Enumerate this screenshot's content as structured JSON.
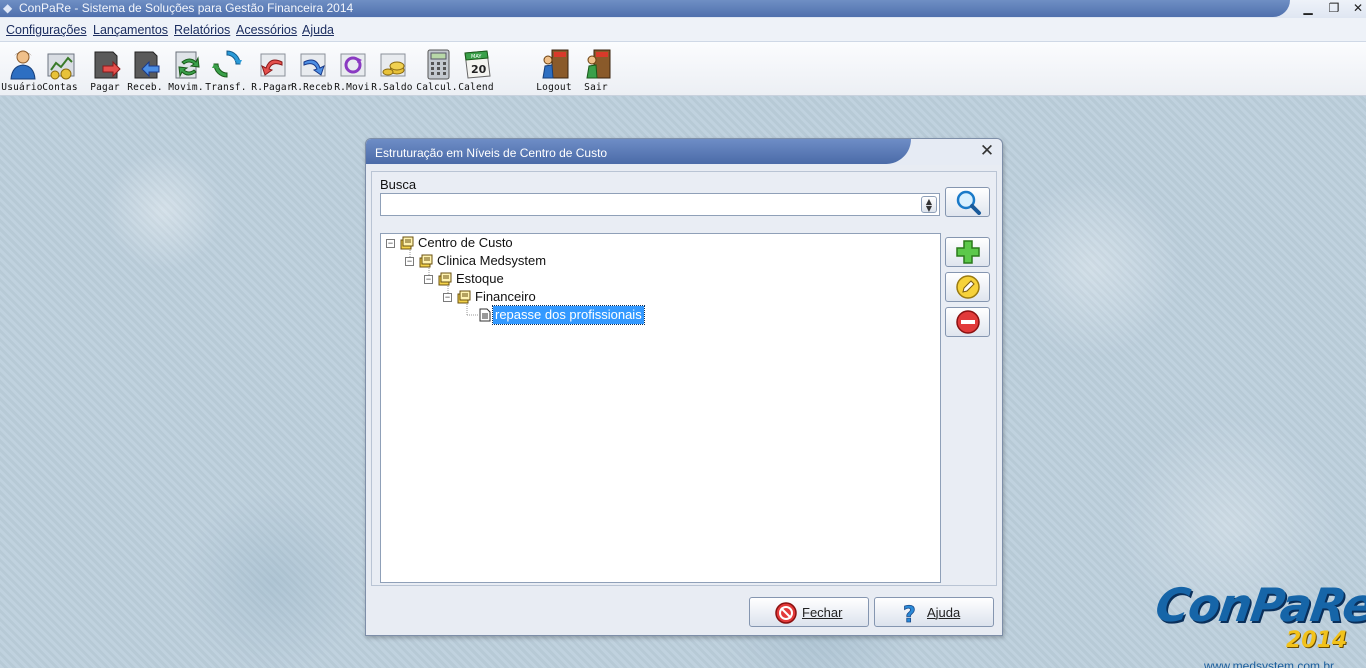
{
  "window": {
    "title": "ConPaRe - Sistema de Soluções para Gestão Financeira 2014",
    "minimize": "▁",
    "restore": "❐",
    "close": "✕"
  },
  "menu": [
    "Configurações",
    "Lançamentos",
    "Relatórios",
    "Acessórios",
    "Ajuda"
  ],
  "toolbar": [
    {
      "label": "Usuário",
      "icon": "user-icon"
    },
    {
      "label": "Contas",
      "icon": "accounts-icon"
    },
    {
      "label": "Pagar",
      "icon": "pay-icon"
    },
    {
      "label": "Receb.",
      "icon": "receive-icon"
    },
    {
      "label": "Movim.",
      "icon": "movement-icon"
    },
    {
      "label": "Transf.",
      "icon": "transfer-icon"
    },
    {
      "label": "R.Pagar",
      "icon": "report-pay-icon"
    },
    {
      "label": "R.Receb",
      "icon": "report-receive-icon"
    },
    {
      "label": "R.Movi",
      "icon": "report-movement-icon"
    },
    {
      "label": "R.Saldo",
      "icon": "report-balance-icon"
    },
    {
      "label": "Calcul.",
      "icon": "calculator-icon"
    },
    {
      "label": "Calend",
      "icon": "calendar-icon"
    },
    {
      "label": "Logout",
      "icon": "logout-icon"
    },
    {
      "label": "Sair",
      "icon": "exit-icon"
    }
  ],
  "calendar_icon": {
    "month": "MAY",
    "day": "20"
  },
  "dialog": {
    "title": "Estruturação em Níveis de Centro de Custo",
    "busca_label": "Busca",
    "busca_value": "",
    "tree": [
      {
        "label": "Centro de Custo",
        "level": 0,
        "expanded": true
      },
      {
        "label": "Clinica Medsystem",
        "level": 1,
        "expanded": true
      },
      {
        "label": "Estoque",
        "level": 2,
        "expanded": true
      },
      {
        "label": "Financeiro",
        "level": 3,
        "expanded": true
      },
      {
        "label": "repasse dos profissionais",
        "level": 4,
        "selected": true
      }
    ],
    "buttons": {
      "close": "Fechar",
      "help": "Ajuda"
    }
  },
  "logo": {
    "name": "ConPaRe",
    "year": "2014",
    "url": "www.medsystem.com.br"
  },
  "colors": {
    "accent": "#4f70ad",
    "selection": "#3399ff",
    "logo_blue": "#1665a8",
    "logo_gold": "#f2c21b"
  }
}
